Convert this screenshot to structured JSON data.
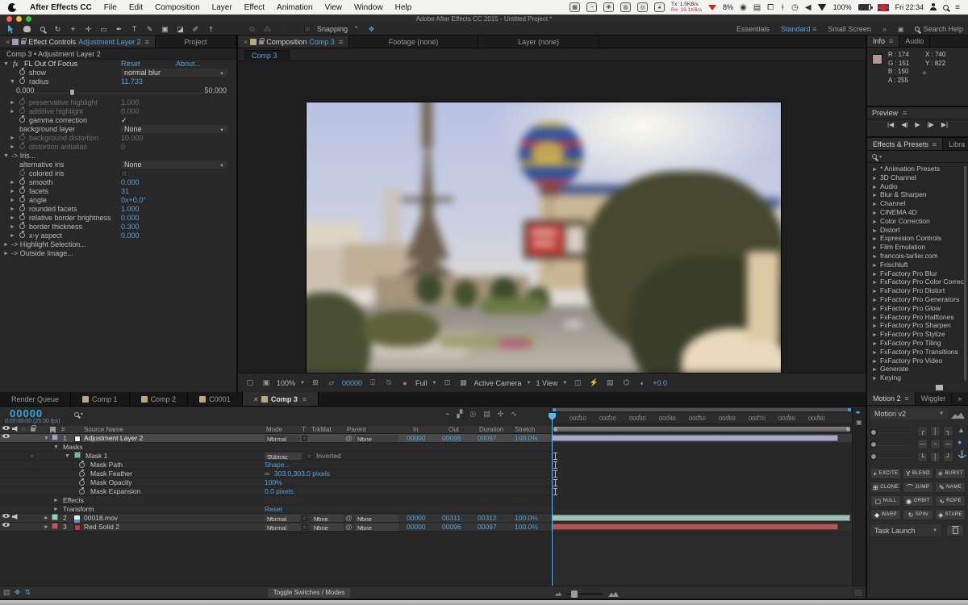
{
  "menubar": {
    "app_name": "After Effects CC",
    "items": [
      "File",
      "Edit",
      "Composition",
      "Layer",
      "Effect",
      "Animation",
      "View",
      "Window",
      "Help"
    ],
    "status": {
      "tx": "Tx: 1.5KB/s",
      "rx": "Rx: 19.1KB/s",
      "battery_pct": "8%",
      "volume_pct": "100%",
      "clock": "Fri 22:34"
    }
  },
  "titlebar": {
    "title": "Adobe After Effects CC 2015 - Untitled Project *"
  },
  "toolbar": {
    "tools": [
      {
        "name": "selection-tool",
        "glyph": ""
      },
      {
        "name": "hand-tool",
        "glyph": ""
      },
      {
        "name": "zoom-tool",
        "glyph": ""
      },
      {
        "name": "rotation-tool",
        "glyph": "↻"
      },
      {
        "name": "unified-camera-tool",
        "glyph": "⌖"
      },
      {
        "name": "pan-behind-tool",
        "glyph": "✛"
      },
      {
        "name": "shape-tool",
        "glyph": "▭"
      },
      {
        "name": "pen-tool",
        "glyph": "✒"
      },
      {
        "name": "type-tool",
        "glyph": "T"
      },
      {
        "name": "brush-tool",
        "glyph": "✎"
      },
      {
        "name": "clone-stamp-tool",
        "glyph": "▣"
      },
      {
        "name": "eraser-tool",
        "glyph": "◪"
      },
      {
        "name": "roto-brush-tool",
        "glyph": "✐"
      },
      {
        "name": "puppet-pin-tool",
        "glyph": "†"
      }
    ],
    "snapping_label": "Snapping",
    "workspaces": [
      "Essentials",
      "Standard",
      "Small Screen"
    ],
    "active_workspace": "Standard",
    "search_help": "Search Help"
  },
  "effect_controls": {
    "tab_label": "Effect Controls",
    "tab_target": "Adjustment Layer 2",
    "tab2": "Project",
    "breadcrumb": "Comp 3 • Adjustment Layer 2",
    "fx_glyph": "fx",
    "effect_name": "FL Out Of Focus",
    "reset_label": "Reset",
    "about_label": "About...",
    "rows": [
      {
        "type": "dropdown",
        "arrow": "",
        "stopwatch": true,
        "label": "show",
        "value": "normal blur"
      },
      {
        "type": "value",
        "arrow": "▼",
        "stopwatch": true,
        "label": "radius",
        "value": "11.733"
      },
      {
        "type": "slider",
        "min": "0.000",
        "max": "50.000",
        "pos": 0.26
      },
      {
        "type": "gray",
        "arrow": "►",
        "stopwatch": true,
        "label": "preservative highlight",
        "value": "1.000"
      },
      {
        "type": "gray",
        "arrow": "►",
        "stopwatch": true,
        "label": "additive highlight",
        "value": "0.000"
      },
      {
        "type": "check",
        "arrow": "",
        "stopwatch": true,
        "label": "gamma correction",
        "checked": true
      },
      {
        "type": "dropdown",
        "arrow": "",
        "stopwatch": false,
        "label": "background layer",
        "value": "None"
      },
      {
        "type": "gray",
        "arrow": "►",
        "stopwatch": true,
        "label": "background distortion",
        "value": "10.000"
      },
      {
        "type": "gray",
        "arrow": "►",
        "stopwatch": true,
        "label": "distortion antialias",
        "value": "0"
      },
      {
        "type": "group",
        "arrow": "▼",
        "label": "-> Iris..."
      },
      {
        "type": "dropdown",
        "arrow": "",
        "stopwatch": false,
        "label": "alternative iris",
        "value": "None"
      },
      {
        "type": "check",
        "arrow": "",
        "stopwatch": true,
        "label": "colored iris",
        "checked": false,
        "gray": true
      },
      {
        "type": "value",
        "arrow": "►",
        "stopwatch": true,
        "label": "smooth",
        "value": "0.000"
      },
      {
        "type": "value",
        "arrow": "►",
        "stopwatch": true,
        "label": "facets",
        "value": "31"
      },
      {
        "type": "value",
        "arrow": "►",
        "stopwatch": true,
        "label": "angle",
        "value": "0x+0.0°"
      },
      {
        "type": "value",
        "arrow": "►",
        "stopwatch": true,
        "label": "rounded facets",
        "value": "1.000"
      },
      {
        "type": "value",
        "arrow": "►",
        "stopwatch": true,
        "label": "relative border brightness",
        "value": "0.000"
      },
      {
        "type": "value",
        "arrow": "►",
        "stopwatch": true,
        "label": "border thickness",
        "value": "0.300"
      },
      {
        "type": "value",
        "arrow": "►",
        "stopwatch": true,
        "label": "x-y aspect",
        "value": "0.000"
      },
      {
        "type": "group",
        "arrow": "►",
        "label": "-> Highlight Selection..."
      },
      {
        "type": "group",
        "arrow": "►",
        "label": "-> Outside Image..."
      }
    ]
  },
  "viewer": {
    "tab_label": "Composition",
    "tab_target": "Comp 3",
    "tab2": "Footage (none)",
    "tab3": "Layer (none)",
    "subtab": "Comp 3",
    "bottom": {
      "zoom": "100%",
      "frame": "00000",
      "resolution": "Full",
      "camera": "Active Camera",
      "view": "1 View",
      "exposure": "+0.0"
    }
  },
  "info_panel": {
    "tab": "Info",
    "tab2": "Audio",
    "swatch": "#ae9796",
    "r": "R : 174",
    "g": "G : 151",
    "b": "B : 150",
    "a": "A : 255",
    "x": "X : 740",
    "y": "Y : 822"
  },
  "preview_panel": {
    "title": "Preview",
    "transport": [
      "|◀",
      "◀|",
      "▶",
      "|▶",
      "▶|"
    ]
  },
  "effects_presets": {
    "tab": "Effects & Presets",
    "tab2": "Libra",
    "overflow": "»",
    "categories": [
      "* Animation Presets",
      "3D Channel",
      "Audio",
      "Blur & Sharpen",
      "Channel",
      "CINEMA 4D",
      "Color Correction",
      "Distort",
      "Expression Controls",
      "Film Emulation",
      "francois-tarlier.com",
      "Frischluft",
      "FxFactory Pro Blur",
      "FxFactory Pro Color Correction",
      "FxFactory Pro Distort",
      "FxFactory Pro Generators",
      "FxFactory Pro Glow",
      "FxFactory Pro Halftones",
      "FxFactory Pro Sharpen",
      "FxFactory Pro Stylize",
      "FxFactory Pro Tiling",
      "FxFactory Pro Transitions",
      "FxFactory Pro Video",
      "Generate",
      "Keying"
    ]
  },
  "bottom_tabs": {
    "tabs": [
      {
        "label": "Render Queue",
        "swatch": null
      },
      {
        "label": "Comp 1",
        "swatch": "#b8a884"
      },
      {
        "label": "Comp 2",
        "swatch": "#b8a884"
      },
      {
        "label": "C0001",
        "swatch": "#b8a884"
      }
    ],
    "active": {
      "label": "Comp 3",
      "swatch": "#b8a884"
    }
  },
  "timeline": {
    "time_display": "00000",
    "time_sub": "0:00:00:00 (25.00 fps)",
    "columns": {
      "hash": "#",
      "source": "Source Name",
      "mode": "Mode",
      "t": "T",
      "trkmat": "TrkMat",
      "parent": "Parent",
      "in": "In",
      "out": "Out",
      "duration": "Duration",
      "stretch": "Stretch"
    },
    "rows": [
      {
        "kind": "layer",
        "selected": true,
        "eye": true,
        "audio": false,
        "expander": "▼",
        "swatch": "#9d9dc0",
        "num": "1",
        "icon": "#ececec",
        "name": "Adjustment Layer 2",
        "mode": "Normal",
        "trkmat": null,
        "parent": "None",
        "in": "00000",
        "out": "00096",
        "dur": "00097",
        "stretch": "100.0%",
        "bar": "#a8a8c8",
        "bar_end": 0.96
      },
      {
        "kind": "group",
        "arrow": "▼",
        "label": "Masks"
      },
      {
        "kind": "mask",
        "arrow": "▼",
        "swatch": "#7fb3a4",
        "label": "Mask 1",
        "mode": "Subtrac",
        "inverted": "Inverted"
      },
      {
        "kind": "prop",
        "label": "Mask Path",
        "value": "Shape..."
      },
      {
        "kind": "prop",
        "label": "Mask Feather",
        "value": "303.0,303.0 pixels",
        "link": "∞"
      },
      {
        "kind": "prop",
        "label": "Mask Opacity",
        "value": "100%"
      },
      {
        "kind": "prop",
        "label": "Mask Expansion",
        "value": "0.0 pixels"
      },
      {
        "kind": "group",
        "arrow": "►",
        "label": "Effects"
      },
      {
        "kind": "group",
        "arrow": "►",
        "label": "Transform",
        "value": "Reset"
      },
      {
        "kind": "layer",
        "selected": false,
        "eye": true,
        "audio": true,
        "expander": "►",
        "swatch": "#9fc6c0",
        "num": "2",
        "icon": "file",
        "name": "00018.mov",
        "mode": "Normal",
        "trkmat": "None",
        "parent": "None",
        "in": "00000",
        "out": "00311",
        "dur": "00312",
        "stretch": "100.0%",
        "bar": "#9fc0b4",
        "bar_end": 1.0
      },
      {
        "kind": "layer",
        "selected": false,
        "eye": true,
        "audio": false,
        "expander": "►",
        "swatch": "#c05b5b",
        "num": "3",
        "icon": "#d03535",
        "name": "Red Solid 2",
        "mode": "Normal",
        "trkmat": "None",
        "parent": "None",
        "in": "00000",
        "out": "00096",
        "dur": "00097",
        "stretch": "100.0%",
        "bar": "#b25555",
        "bar_end": 0.96
      }
    ],
    "ruler_ticks": [
      "00010",
      "00020",
      "00030",
      "00040",
      "00050",
      "00060",
      "00070",
      "00080",
      "00090"
    ],
    "toggle_button": "Toggle Switches / Modes"
  },
  "motion_panel": {
    "tab": "Motion 2",
    "tab2": "Wiggler",
    "overflow": "»",
    "preset": "Motion v2",
    "anchor_grid": [
      "┌",
      "│",
      "┐",
      "─",
      "▫",
      "─",
      "└",
      "│",
      "┘"
    ],
    "side_icons": [
      {
        "name": "rocket-icon",
        "glyph": "▲"
      },
      {
        "name": "indicator-dot-icon",
        "glyph": "●"
      },
      {
        "name": "anchor-icon",
        "glyph": "⚓"
      }
    ],
    "buttons": [
      {
        "glyph": "+",
        "label": "EXCITE"
      },
      {
        "glyph": "Y",
        "label": "BLEND"
      },
      {
        "glyph": "✳",
        "label": "BURST"
      },
      {
        "glyph": "⊞",
        "label": "CLONE"
      },
      {
        "glyph": "⌒",
        "label": "JUMP"
      },
      {
        "glyph": "✎",
        "label": "NAME"
      },
      {
        "glyph": "▢",
        "label": "NULL"
      },
      {
        "glyph": "◉",
        "label": "ORBIT"
      },
      {
        "glyph": "∿",
        "label": "ROPE"
      },
      {
        "glyph": "◆",
        "label": "WARP"
      },
      {
        "glyph": "↻",
        "label": "SPIN"
      },
      {
        "glyph": "◈",
        "label": "STARE"
      }
    ],
    "task_launch": "Task Launch"
  }
}
